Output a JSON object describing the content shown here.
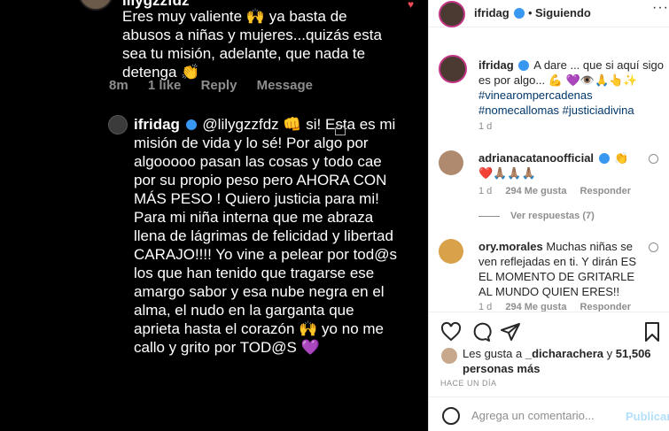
{
  "left_image": {
    "top_comment_user": "lilygzzfdz",
    "top_comment_text": "Eres muy valiente 🙌 ya basta de abusos a niñas y mujeres...quizás esta sea tu misión,  adelante, que nada te detenga 👏",
    "meta_time": "8m",
    "meta_likes": "1 like",
    "meta_reply": "Reply",
    "meta_message": "Message",
    "reply_user": "ifridag",
    "reply_text": "@lilygzzfdz 👊 si! Esta es mi misión de vida y lo sé! Por algo por algooooo pasan las cosas y todo cae por su propio peso pero AHORA CON MÁS PESO ! Quiero justicia para mi! Para mi niña interna que me abraza llena de lágrimas de felicidad y libertad CARAJO!!!! Yo vine a pelear por tod@s los que han tenido que tragarse ese amargo sabor y esa nube negra en el alma, el nudo en la garganta que aprieta hasta el corazón 🙌 yo no me callo y grito por TOD@S 💜"
  },
  "header": {
    "username": "ifridag",
    "dot": "•",
    "follow_label": "Siguiendo",
    "more": "···"
  },
  "caption": {
    "username": "ifridag",
    "text": "A dare ... que si aquí sigo es por algo... 💪 💜👁️🙏👆✨",
    "tags": "#vinearompercadenas #nomecallomas #justiciadivina",
    "time": "1 d"
  },
  "comments": [
    {
      "username": "adrianacatanoofficial",
      "text": "👏❤️🙏🏽🙏🏽🙏🏽",
      "time": "1 d",
      "likes": "294 Me gusta",
      "reply": "Responder",
      "view_replies": "Ver respuestas (7)",
      "avatar_color": "#b08a6e"
    },
    {
      "username": "ory.morales",
      "text": "Muchas niñas se ven reflejadas en ti. Y dirán ES EL MOMENTO DE GRITARLE AL MUNDO QUIEN ERES!!",
      "time": "1 d",
      "likes": "294 Me gusta",
      "reply": "Responder",
      "avatar_color": "#d9a24a"
    }
  ],
  "likes": {
    "prefix": "Les gusta a",
    "user": "_dicharachera",
    "middle": "y",
    "count": "51,506 personas más"
  },
  "ago": "HACE UN DÍA",
  "add_comment": {
    "placeholder": "Agrega un comentario...",
    "publish": "Publicar"
  },
  "colors": {
    "verified": "#3897f0",
    "story_ring": "#c13584",
    "publish": "#b2dffc"
  }
}
